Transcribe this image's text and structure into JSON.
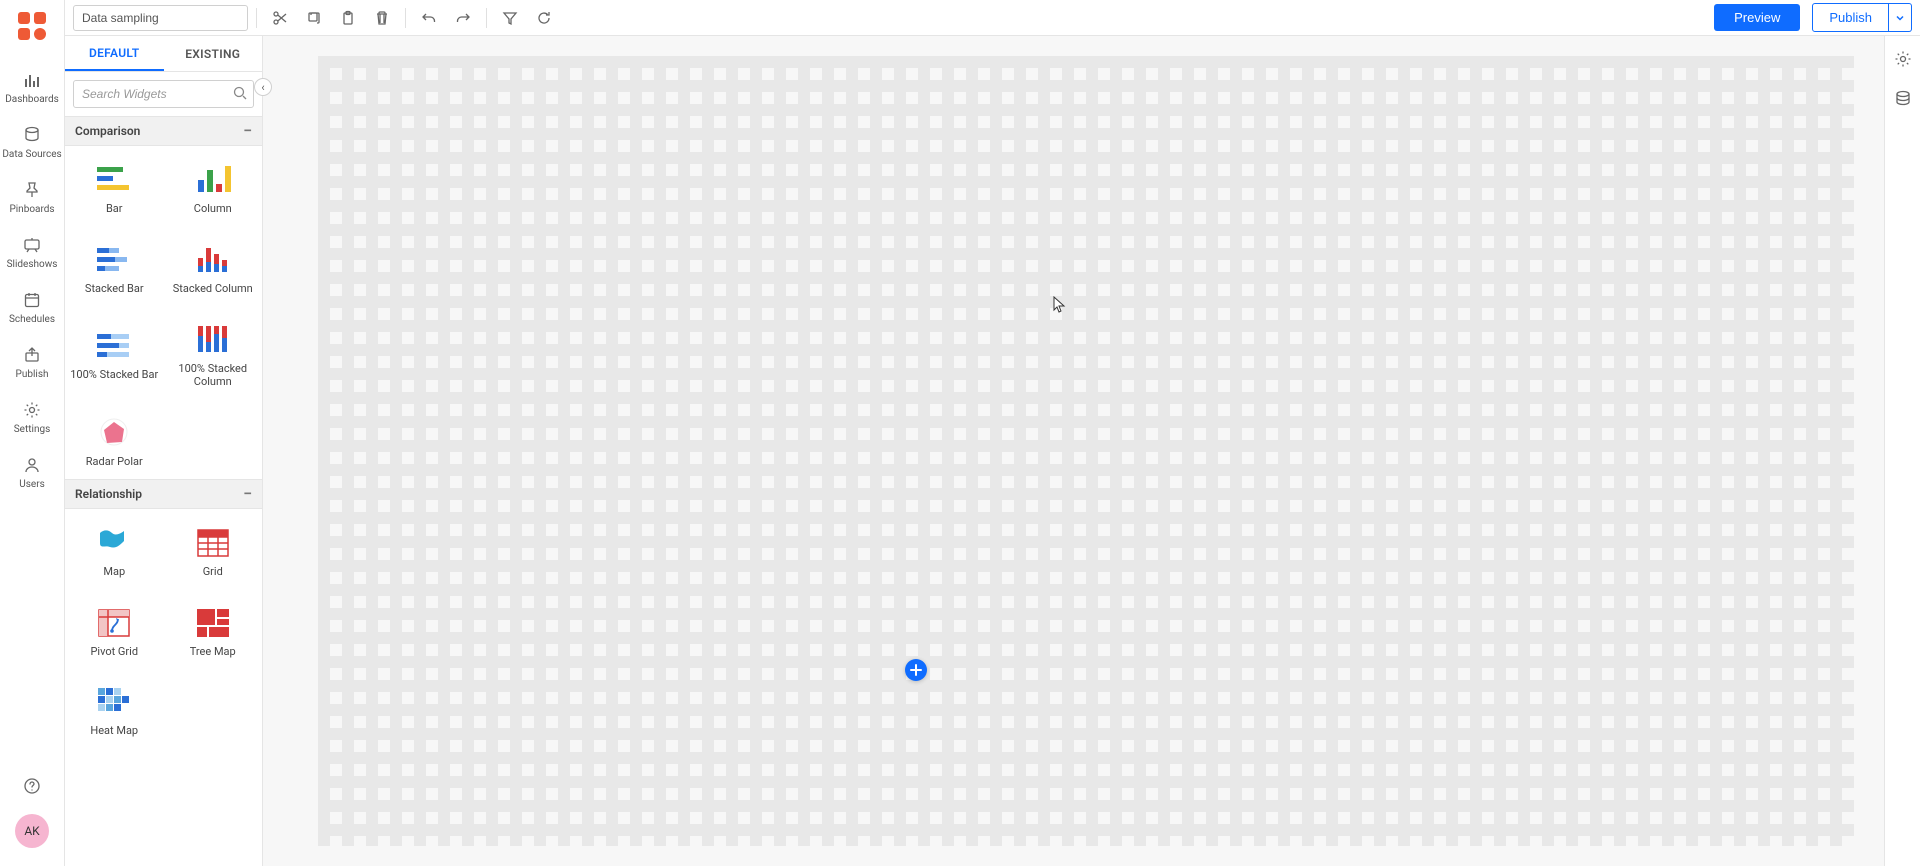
{
  "dashboardTitle": "Data sampling",
  "rail": {
    "items": [
      {
        "key": "dashboards",
        "label": "Dashboards"
      },
      {
        "key": "datasources",
        "label": "Data Sources"
      },
      {
        "key": "pinboards",
        "label": "Pinboards"
      },
      {
        "key": "slideshows",
        "label": "Slideshows"
      },
      {
        "key": "schedules",
        "label": "Schedules"
      },
      {
        "key": "publish",
        "label": "Publish"
      },
      {
        "key": "settings",
        "label": "Settings"
      },
      {
        "key": "users",
        "label": "Users"
      }
    ],
    "avatar": "AK"
  },
  "toolbar": {
    "preview": "Preview",
    "publish": "Publish"
  },
  "widgetPanel": {
    "tabs": {
      "default": "DEFAULT",
      "existing": "EXISTING"
    },
    "searchPlaceholder": "Search Widgets",
    "categories": [
      {
        "name": "Comparison",
        "widgets": [
          {
            "key": "bar",
            "label": "Bar"
          },
          {
            "key": "column",
            "label": "Column"
          },
          {
            "key": "stacked-bar",
            "label": "Stacked Bar"
          },
          {
            "key": "stacked-column",
            "label": "Stacked Column"
          },
          {
            "key": "100-stacked-bar",
            "label": "100% Stacked Bar"
          },
          {
            "key": "100-stacked-column",
            "label": "100% Stacked Column"
          },
          {
            "key": "radar-polar",
            "label": "Radar Polar"
          }
        ]
      },
      {
        "name": "Relationship",
        "widgets": [
          {
            "key": "map",
            "label": "Map"
          },
          {
            "key": "grid",
            "label": "Grid"
          },
          {
            "key": "pivot-grid",
            "label": "Pivot Grid"
          },
          {
            "key": "tree-map",
            "label": "Tree Map"
          },
          {
            "key": "heat-map",
            "label": "Heat Map"
          }
        ]
      }
    ]
  }
}
